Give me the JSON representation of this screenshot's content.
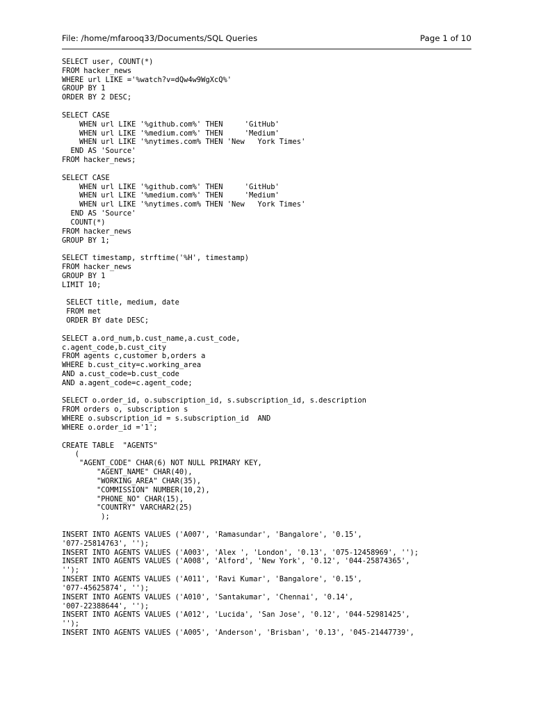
{
  "header": {
    "file_label": "File: /home/mfarooq33/Documents/SQL Queries",
    "page_label": "Page 1 of 10"
  },
  "document": {
    "title": "SQL Queries",
    "page_current": 1,
    "page_total": 10,
    "file_path": "/home/mfarooq33/Documents/SQL Queries"
  },
  "code": {
    "blocks": [
      {
        "id": "query-count-users-by-url",
        "lines": [
          "SELECT user, COUNT(*)",
          "FROM hacker_news",
          "WHERE url LIKE ='%watch?v=dQw4w9WgXcQ%'",
          "GROUP BY 1",
          "ORDER BY 2 DESC;"
        ]
      },
      {
        "id": "query-case-source",
        "lines": [
          "SELECT CASE",
          "    WHEN url LIKE '%github.com%' THEN     'GitHub'",
          "    WHEN url LIKE '%medium.com%' THEN     'Medium'",
          "    WHEN url LIKE '%nytimes.com% THEN 'New   York Times'",
          "  END AS 'Source'",
          "FROM hacker_news;"
        ]
      },
      {
        "id": "query-case-source-count",
        "lines": [
          "SELECT CASE",
          "    WHEN url LIKE '%github.com%' THEN     'GitHub'",
          "    WHEN url LIKE '%medium.com%' THEN     'Medium'",
          "    WHEN url LIKE '%nytimes.com% THEN 'New   York Times'",
          "  END AS 'Source'",
          "  COUNT(*)",
          "FROM hacker_news",
          "GROUP BY 1;"
        ]
      },
      {
        "id": "query-timestamp-strftime",
        "lines": [
          "SELECT timestamp, strftime('%H', timestamp)",
          "FROM hacker_news",
          "GROUP BY 1",
          "LIMIT 10;"
        ]
      },
      {
        "id": "query-met-titles",
        "lines": [
          " SELECT title, medium, date",
          " FROM met",
          " ORDER BY date DESC;"
        ]
      },
      {
        "id": "query-agents-customer-orders-join",
        "lines": [
          "SELECT a.ord_num,b.cust_name,a.cust_code,",
          "c.agent_code,b.cust_city",
          "FROM agents c,customer b,orders a",
          "WHERE b.cust_city=c.working_area",
          "AND a.cust_code=b.cust_code",
          "AND a.agent_code=c.agent_code;"
        ]
      },
      {
        "id": "query-orders-subscription-join",
        "lines": [
          "SELECT o.order_id, o.subscription_id, s.subscription_id, s.description",
          "FROM orders o, subscription s",
          "WHERE o.subscription_id = s.subscription_id  AND",
          "WHERE o.order_id ='1';"
        ]
      },
      {
        "id": "ddl-create-table-agents",
        "lines": [
          "CREATE TABLE  \"AGENTS\"",
          "   (",
          "    \"AGENT_CODE\" CHAR(6) NOT NULL PRIMARY KEY,",
          "        \"AGENT_NAME\" CHAR(40),",
          "        \"WORKING_AREA\" CHAR(35),",
          "        \"COMMISSION\" NUMBER(10,2),",
          "        \"PHONE_NO\" CHAR(15),",
          "        \"COUNTRY\" VARCHAR2(25)",
          "         );"
        ]
      },
      {
        "id": "dml-insert-agents",
        "lines": [
          "INSERT INTO AGENTS VALUES ('A007', 'Ramasundar', 'Bangalore', '0.15',",
          "'077-25814763', '');",
          "INSERT INTO AGENTS VALUES ('A003', 'Alex ', 'London', '0.13', '075-12458969', '');",
          "INSERT INTO AGENTS VALUES ('A008', 'Alford', 'New York', '0.12', '044-25874365',",
          "'');",
          "INSERT INTO AGENTS VALUES ('A011', 'Ravi Kumar', 'Bangalore', '0.15',",
          "'077-45625874', '');",
          "INSERT INTO AGENTS VALUES ('A010', 'Santakumar', 'Chennai', '0.14',",
          "'007-22388644', '');",
          "INSERT INTO AGENTS VALUES ('A012', 'Lucida', 'San Jose', '0.12', '044-52981425',",
          "'');",
          "INSERT INTO AGENTS VALUES ('A005', 'Anderson', 'Brisban', '0.13', '045-21447739',"
        ]
      }
    ]
  }
}
